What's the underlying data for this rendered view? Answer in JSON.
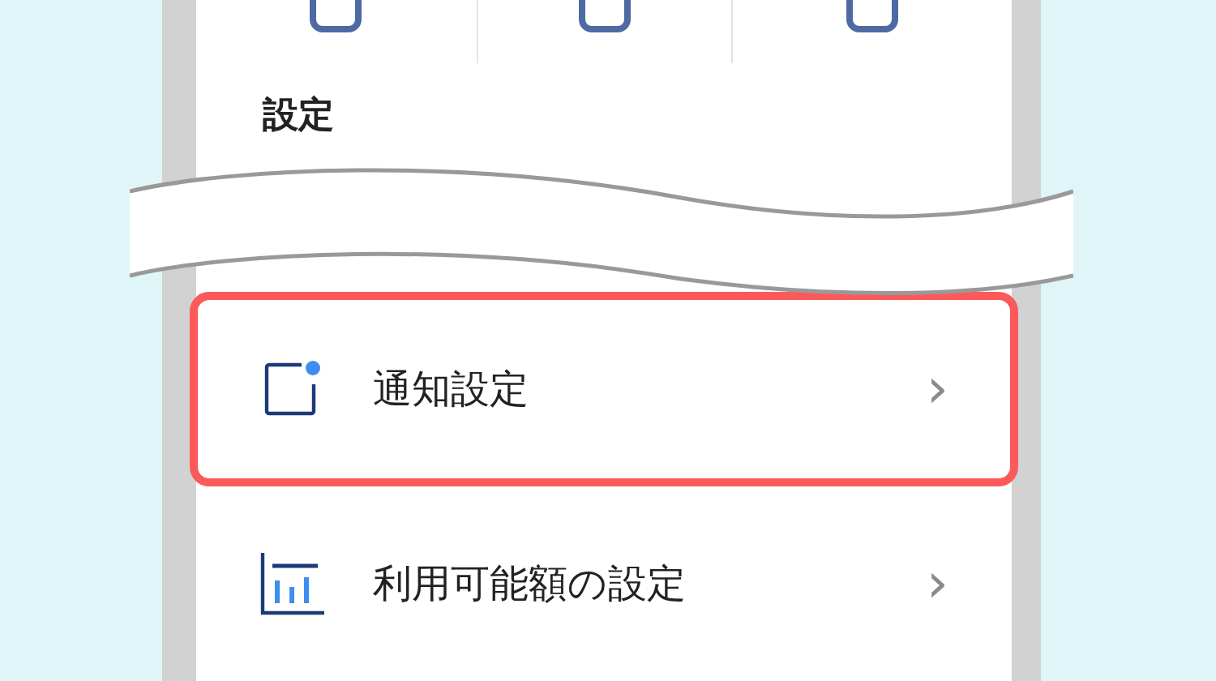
{
  "section_title": "設定",
  "items": [
    {
      "label": "通知設定",
      "kind": "notice",
      "highlighted": true,
      "chevron": "›"
    },
    {
      "label": "利用可能額の設定",
      "kind": "chart",
      "highlighted": false,
      "chevron": "›"
    }
  ]
}
